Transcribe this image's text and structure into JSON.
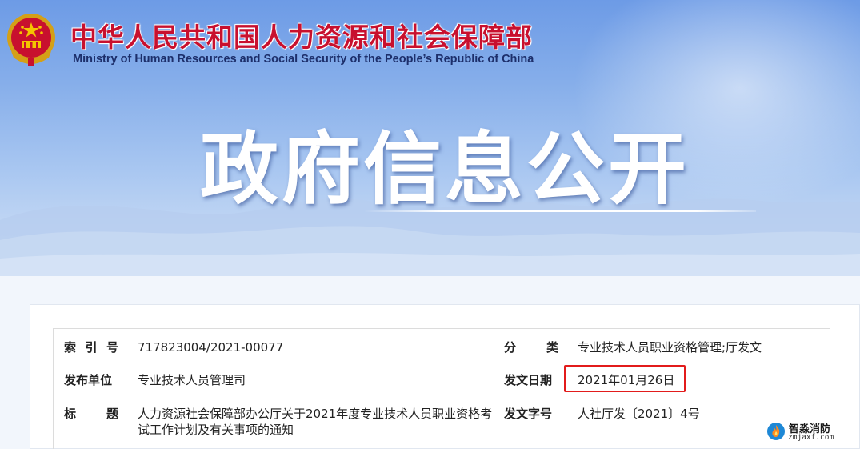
{
  "header": {
    "org_name_zh": "中华人民共和国人力资源和社会保障部",
    "org_name_en": "Ministry of Human Resources and Social Security of the People’s Republic of China",
    "emblem_icon": "national-emblem-icon"
  },
  "banner": {
    "title": "政府信息公开"
  },
  "document_meta": {
    "index_no": {
      "label_chars": [
        "索",
        "引",
        "号"
      ],
      "value": "717823004/2021-00077"
    },
    "category": {
      "label_chars": [
        "分",
        "类"
      ],
      "value": "专业技术人员职业资格管理;厅发文"
    },
    "issuer": {
      "label": "发布单位",
      "value": "专业技术人员管理司"
    },
    "issue_date": {
      "label": "发文日期",
      "value": "2021年01月26日"
    },
    "title": {
      "label_chars": [
        "标",
        "题"
      ],
      "value": "人力资源社会保障部办公厅关于2021年度专业技术人员职业资格考试工作计划及有关事项的通知"
    },
    "doc_number": {
      "label": "发文字号",
      "value": "人社厅发〔2021〕4号"
    }
  },
  "watermark": {
    "name_zh": "智淼消防",
    "domain": "zmjaxf.com",
    "icon": "flame-logo-icon"
  },
  "colors": {
    "brand_red": "#c8102e",
    "highlight_red": "#e21b1b",
    "banner_blue": "#86aeea",
    "en_name_navy": "#1d2f6b"
  }
}
